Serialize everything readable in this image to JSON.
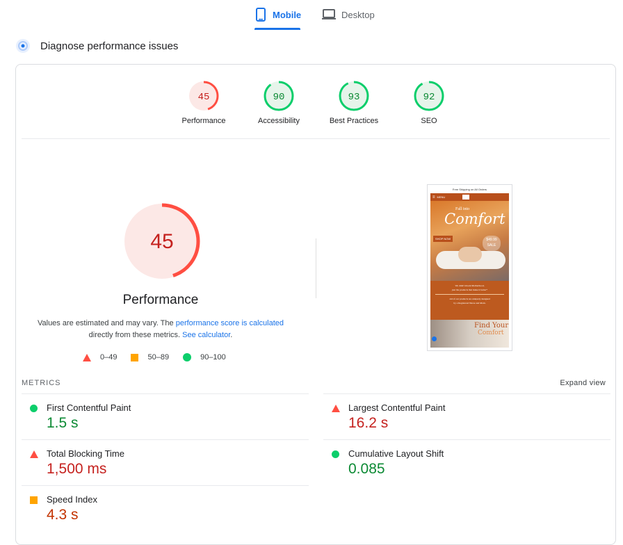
{
  "tabs": {
    "mobile": "Mobile",
    "desktop": "Desktop"
  },
  "diagnose_title": "Diagnose performance issues",
  "scores": [
    {
      "label": "Performance",
      "value": "45"
    },
    {
      "label": "Accessibility",
      "value": "90"
    },
    {
      "label": "Best Practices",
      "value": "93"
    },
    {
      "label": "SEO",
      "value": "92"
    }
  ],
  "main_score": {
    "value": "45",
    "title": "Performance",
    "fraction": 0.45
  },
  "note": {
    "p1": "Values are estimated and may vary. The ",
    "link1": "performance score is calculated",
    "p2": " directly from these metrics. ",
    "link2": "See calculator",
    "p3": "."
  },
  "legend": {
    "bad": "0–49",
    "avg": "50–89",
    "good": "90–100"
  },
  "metrics_heading": "METRICS",
  "expand_view": "Expand view",
  "metrics": [
    {
      "name": "First Contentful Paint",
      "value": "1.5 s"
    },
    {
      "name": "Largest Contentful Paint",
      "value": "16.2 s"
    },
    {
      "name": "Total Blocking Time",
      "value": "1,500 ms"
    },
    {
      "name": "Cumulative Layout Shift",
      "value": "0.085"
    },
    {
      "name": "Speed Index",
      "value": "4.3 s"
    }
  ],
  "screenshot": {
    "banner": "Free Shipping on All Orders",
    "menu": "MENU",
    "hero_small": "Fall into",
    "hero_big": "Comfort",
    "shop_now": "SHOP NOW",
    "price": "$49.99",
    "sale": "SALE",
    "copy1": "We didn't invent Motherhood,",
    "copy2": "just the products that make it better*",
    "copy3": "All of our products are uniquely designed",
    "copy4": "by a Registered Nurse and Mom.",
    "find": "Find Your",
    "find2": "Comfort"
  },
  "colors": {
    "good": "#0cce6b",
    "good_text": "#0c8a34",
    "bad": "#ff4e42",
    "bad_text": "#c5221f",
    "avg": "#ffa400",
    "accent": "#1a73e8"
  }
}
